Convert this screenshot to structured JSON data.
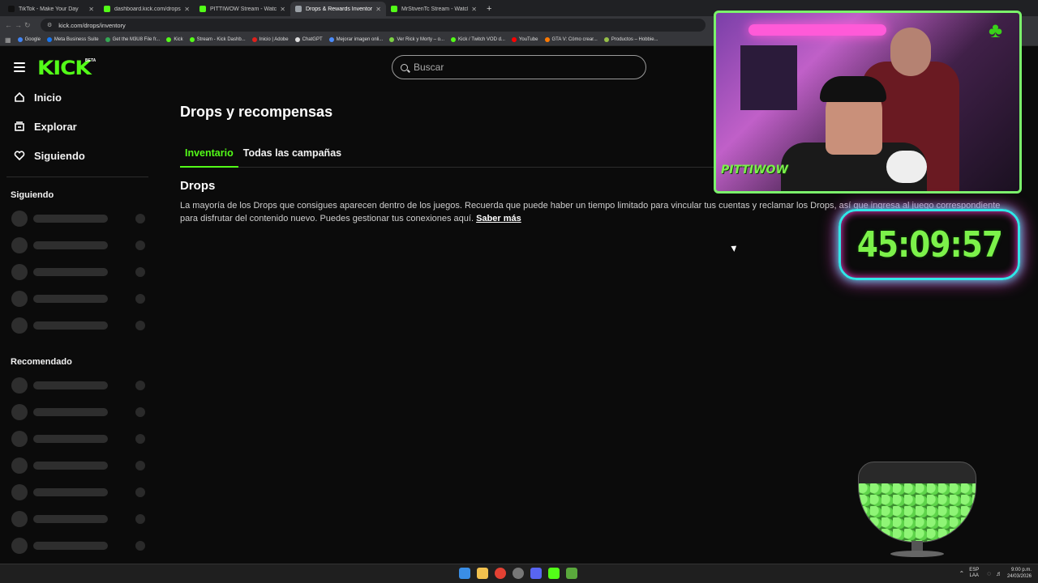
{
  "browser": {
    "tabs": [
      {
        "title": "TikTok - Make Your Day",
        "color": "#111111",
        "active": false
      },
      {
        "title": "dashboard.kick.com/drops",
        "color": "#53fc18",
        "active": false
      },
      {
        "title": "PITTIWOW Stream - Watch Liv",
        "color": "#53fc18",
        "active": false
      },
      {
        "title": "Drops & Rewards Inventory - K",
        "color": "#9aa0a6",
        "active": true
      },
      {
        "title": "MrStivenTc Stream - Watch Liv",
        "color": "#53fc18",
        "active": false
      }
    ],
    "url": "kick.com/drops/inventory",
    "bookmarks": [
      {
        "label": "Google",
        "color": "#4285f4"
      },
      {
        "label": "Meta Business Suite",
        "color": "#1877f2"
      },
      {
        "label": "Get the M3U8 File fr...",
        "color": "#34a853"
      },
      {
        "label": "Kick",
        "color": "#53fc18"
      },
      {
        "label": "Stream - Kick Dashb...",
        "color": "#53fc18"
      },
      {
        "label": "Inicio | Adobe",
        "color": "#e0201b"
      },
      {
        "label": "ChatGPT",
        "color": "#dddddd"
      },
      {
        "label": "Mejorar imagen onli...",
        "color": "#4a8cff"
      },
      {
        "label": "Ver Rick y Morty – o...",
        "color": "#7bd143"
      },
      {
        "label": "Kick / Twitch VOD d...",
        "color": "#53fc18"
      },
      {
        "label": "YouTube",
        "color": "#ff0000"
      },
      {
        "label": "GTA V: Cómo crear...",
        "color": "#ff7a00"
      },
      {
        "label": "Productos – Hobbie...",
        "color": "#96bf48"
      }
    ]
  },
  "header": {
    "logo": "KICK",
    "logo_badge": "BETA",
    "search_placeholder": "Buscar"
  },
  "sidebar": {
    "nav": [
      {
        "label": "Inicio",
        "icon": "home-icon"
      },
      {
        "label": "Explorar",
        "icon": "explore-icon"
      },
      {
        "label": "Siguiendo",
        "icon": "heart-icon"
      }
    ],
    "following_title": "Siguiendo",
    "recommended_title": "Recomendado"
  },
  "main": {
    "title": "Drops y recompensas",
    "tabs": [
      "Inventario",
      "Todas las campañas"
    ],
    "section_title": "Drops",
    "description": "La mayoría de los Drops que consigues aparecen dentro de los juegos. Recuerda que puede haber un tiempo limitado para vincular tus cuentas y reclamar los Drops, así que ingresa al juego correspondiente para disfrutar del contenido nuevo. Puedes gestionar tus conexiones aquí.",
    "learn_more": "Saber más"
  },
  "overlay": {
    "watermark": "PITTIWOW",
    "timer": "45:09:57"
  },
  "taskbar": {
    "lang_top": "ESP",
    "lang_bottom": "LAA",
    "time": "9:00 p.m.",
    "date": "24/03/2026"
  },
  "colors": {
    "accent": "#53fc18",
    "background": "#0b0b0b"
  }
}
